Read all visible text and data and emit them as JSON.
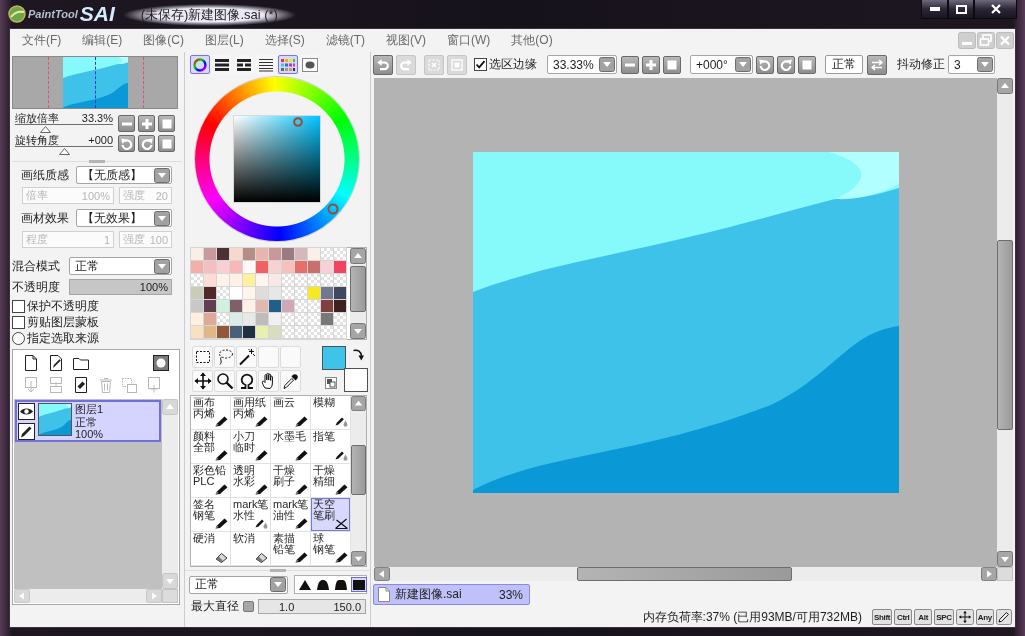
{
  "window": {
    "logo_name": "PaintTool",
    "logo_mark": "SAI",
    "title": "(未保存)新建图像.sai (*)"
  },
  "menu": [
    "文件(F)",
    "编辑(E)",
    "图像(C)",
    "图层(L)",
    "选择(S)",
    "滤镜(T)",
    "视图(V)",
    "窗口(W)",
    "其他(O)"
  ],
  "toolbar": {
    "history": [
      {
        "kind": "undo",
        "disabled": false
      },
      {
        "kind": "redo",
        "disabled": true
      },
      {
        "kind": "deselect",
        "disabled": true
      },
      {
        "kind": "invert",
        "disabled": true
      }
    ],
    "selection_edge": {
      "label": "选区边缘",
      "checked": true
    },
    "zoom": "33.33%",
    "rotation": "+000°",
    "view_mode": "正常",
    "stabilizer": {
      "label": "抖动修正",
      "value": "3"
    }
  },
  "navigator": {
    "zoom": {
      "label": "缩放倍率",
      "value": "33.3%",
      "level": 0.31
    },
    "rotation": {
      "label": "旋转角度",
      "value": "+000",
      "level": 0.5
    }
  },
  "paper_texture": {
    "label": "画纸质感",
    "value": "【无质感】",
    "params": [
      {
        "label": "倍率",
        "value": "100%",
        "disabled": true
      },
      {
        "label": "强度",
        "value": "20",
        "disabled": true
      }
    ]
  },
  "material_effect": {
    "label": "画材效果",
    "value": "【无效果】",
    "params": [
      {
        "label": "程度",
        "value": "1",
        "disabled": true
      },
      {
        "label": "强度",
        "value": "100",
        "disabled": true
      }
    ]
  },
  "layer_properties": {
    "blend": {
      "label": "混合模式",
      "value": "正常"
    },
    "opacity": {
      "label": "不透明度",
      "value": "100%",
      "level": 1
    },
    "options": [
      {
        "kind": "checkbox",
        "label": "保护不透明度",
        "checked": false
      },
      {
        "kind": "checkbox",
        "label": "剪贴图层蒙板",
        "checked": false
      },
      {
        "kind": "radio",
        "label": "指定选取来源",
        "checked": false
      }
    ]
  },
  "layer_tools": [
    {
      "kind": "new-layer",
      "disabled": false
    },
    {
      "kind": "new-vector-layer",
      "disabled": false
    },
    {
      "kind": "new-folder",
      "disabled": false
    },
    {
      "kind": "mask",
      "disabled": false
    },
    {
      "kind": "transfer-down",
      "disabled": true
    },
    {
      "kind": "merge-down",
      "disabled": true
    },
    {
      "kind": "clear",
      "disabled": false
    },
    {
      "kind": "delete",
      "disabled": true
    },
    {
      "kind": "merge-visible",
      "disabled": true
    },
    {
      "kind": "new-mask",
      "disabled": true
    }
  ],
  "layers": [
    {
      "name": "图层1",
      "blend": "正常",
      "opacity": "100%",
      "visible": true,
      "selected": true
    }
  ],
  "color_modes": [
    {
      "kind": "wheel",
      "selected": true
    },
    {
      "kind": "rgb",
      "selected": false
    },
    {
      "kind": "hsv",
      "selected": false
    },
    {
      "kind": "lines",
      "selected": false
    },
    {
      "kind": "swatches",
      "selected": true
    },
    {
      "kind": "scratchpad",
      "selected": false
    }
  ],
  "current_colors": [
    {
      "kind": "foreground",
      "color": "#3ec3ea"
    },
    {
      "kind": "background",
      "color": "#ffffff"
    }
  ],
  "swatches": [
    {
      "kind": "color",
      "color": "#fbeee6"
    },
    {
      "kind": "color",
      "color": "#c99a9c"
    },
    {
      "kind": "color",
      "color": "#4c3036"
    },
    {
      "kind": "color",
      "color": "#f6d8cc"
    },
    {
      "kind": "color",
      "color": "#b68c84"
    },
    {
      "kind": "color",
      "color": "#e8b4ae"
    },
    {
      "kind": "color",
      "color": "#c8989a"
    },
    {
      "kind": "color",
      "color": "#9c7a84"
    },
    {
      "kind": "color",
      "color": "#d4b8bc"
    },
    {
      "kind": "color",
      "color": "#fbefe9"
    },
    {
      "kind": "empty"
    },
    {
      "kind": "empty"
    },
    {
      "kind": "color",
      "color": "#f2b0a8"
    },
    {
      "kind": "color",
      "color": "#f0c0c2"
    },
    {
      "kind": "color",
      "color": "#f8d0d2"
    },
    {
      "kind": "color",
      "color": "#f8b8b8"
    },
    {
      "kind": "color",
      "color": "#fff8f6"
    },
    {
      "kind": "color",
      "color": "#f06262"
    },
    {
      "kind": "color",
      "color": "#f8d2d2"
    },
    {
      "kind": "color",
      "color": "#f8c0ba"
    },
    {
      "kind": "color",
      "color": "#e86e68"
    },
    {
      "kind": "color",
      "color": "#c87070"
    },
    {
      "kind": "color",
      "color": "#f8d0d8"
    },
    {
      "kind": "color",
      "color": "#f04462"
    },
    {
      "kind": "empty"
    },
    {
      "kind": "color",
      "color": "#fcdcd4"
    },
    {
      "kind": "color",
      "color": "#fff2ec"
    },
    {
      "kind": "color",
      "color": "#fff0ea"
    },
    {
      "kind": "color",
      "color": "#fff0a0"
    },
    {
      "kind": "color",
      "color": "#fff4f0"
    },
    {
      "kind": "color",
      "color": "#f8e8e8"
    },
    {
      "kind": "empty"
    },
    {
      "kind": "empty"
    },
    {
      "kind": "empty"
    },
    {
      "kind": "empty"
    },
    {
      "kind": "empty"
    },
    {
      "kind": "color",
      "color": "#c8ccb8"
    },
    {
      "kind": "color",
      "color": "#502828"
    },
    {
      "kind": "empty"
    },
    {
      "kind": "color",
      "color": "#ffffff"
    },
    {
      "kind": "color",
      "color": "#fff4ee"
    },
    {
      "kind": "color",
      "color": "#e0dcdc"
    },
    {
      "kind": "color",
      "color": "#e8e6e6"
    },
    {
      "kind": "empty"
    },
    {
      "kind": "empty"
    },
    {
      "kind": "color",
      "color": "#f8e820"
    },
    {
      "kind": "color",
      "color": "#707890"
    },
    {
      "kind": "color",
      "color": "#404860"
    },
    {
      "kind": "color",
      "color": "#c8c8c8"
    },
    {
      "kind": "color",
      "color": "#604050"
    },
    {
      "kind": "color",
      "color": "#d0f0e0"
    },
    {
      "kind": "color",
      "color": "#806068"
    },
    {
      "kind": "color",
      "color": "#fff0e8"
    },
    {
      "kind": "color",
      "color": "#e0b8b0"
    },
    {
      "kind": "color",
      "color": "#206088"
    },
    {
      "kind": "color",
      "color": "#d0a8b8"
    },
    {
      "kind": "empty"
    },
    {
      "kind": "empty"
    },
    {
      "kind": "color",
      "color": "#804040"
    },
    {
      "kind": "color",
      "color": "#402020"
    },
    {
      "kind": "color",
      "color": "#fff0e0"
    },
    {
      "kind": "color",
      "color": "#e0a898"
    },
    {
      "kind": "empty"
    },
    {
      "kind": "color",
      "color": "#d8ece8"
    },
    {
      "kind": "color",
      "color": "#e8e8e8"
    },
    {
      "kind": "color",
      "color": "#c0bcbc"
    },
    {
      "kind": "color",
      "color": "#f0f0f0"
    },
    {
      "kind": "empty"
    },
    {
      "kind": "empty"
    },
    {
      "kind": "empty"
    },
    {
      "kind": "color",
      "color": "#787878"
    },
    {
      "kind": "empty"
    },
    {
      "kind": "color",
      "color": "#f8e0c0"
    },
    {
      "kind": "color",
      "color": "#e0b888"
    },
    {
      "kind": "color",
      "color": "#905838"
    },
    {
      "kind": "color",
      "color": "#486078"
    },
    {
      "kind": "color",
      "color": "#203040"
    },
    {
      "kind": "color",
      "color": "#e8f0b0"
    },
    {
      "kind": "color",
      "color": "#d8dcc0"
    },
    {
      "kind": "empty"
    },
    {
      "kind": "empty"
    },
    {
      "kind": "empty"
    },
    {
      "kind": "empty"
    },
    {
      "kind": "empty"
    }
  ],
  "brushes": [
    {
      "lines": [
        "画布",
        "丙烯"
      ],
      "kind": "pen",
      "selected": false
    },
    {
      "lines": [
        "画用纸",
        "丙烯"
      ],
      "kind": "pen",
      "selected": false
    },
    {
      "lines": [
        "画云"
      ],
      "kind": "pen",
      "selected": false
    },
    {
      "lines": [
        "模糊"
      ],
      "kind": "water",
      "selected": false
    },
    {
      "lines": [
        "颜料",
        "全部"
      ],
      "kind": "pen",
      "selected": false
    },
    {
      "lines": [
        "小刀",
        "临时"
      ],
      "kind": "pen",
      "selected": false
    },
    {
      "lines": [
        "水墨毛"
      ],
      "kind": "pen",
      "selected": false
    },
    {
      "lines": [
        "指笔"
      ],
      "kind": "water",
      "selected": false
    },
    {
      "lines": [
        "彩色铅",
        "PLC"
      ],
      "kind": "pen",
      "selected": false
    },
    {
      "lines": [
        "透明",
        "水彩"
      ],
      "kind": "pen",
      "selected": false
    },
    {
      "lines": [
        "干燥",
        "刷子"
      ],
      "kind": "pen",
      "selected": false
    },
    {
      "lines": [
        "干燥",
        "精细"
      ],
      "kind": "pen",
      "selected": false
    },
    {
      "lines": [
        "签名",
        "钢笔"
      ],
      "kind": "pen",
      "selected": false
    },
    {
      "lines": [
        "mark笔",
        "水性"
      ],
      "kind": "water",
      "selected": false
    },
    {
      "lines": [
        "mark笔",
        "油性"
      ],
      "kind": "pen",
      "selected": false
    },
    {
      "lines": [
        "天空",
        "笔刷"
      ],
      "kind": "fan",
      "selected": true
    },
    {
      "lines": [
        "硬消"
      ],
      "kind": "eraser",
      "selected": false
    },
    {
      "lines": [
        "软消"
      ],
      "kind": "eraser",
      "selected": false
    },
    {
      "lines": [
        "素描",
        "铅笔"
      ],
      "kind": "pen",
      "selected": false
    },
    {
      "lines": [
        "球",
        "钢笔"
      ],
      "kind": "pen",
      "selected": false
    }
  ],
  "brush_settings": {
    "blend": "正常",
    "shapes": [
      {
        "selected": false
      },
      {
        "selected": false
      },
      {
        "selected": false
      },
      {
        "selected": true
      }
    ],
    "size": {
      "label": "最大直径",
      "scale": "1.0",
      "value": "150.0"
    }
  },
  "document_tabs": [
    {
      "name": "新建图像.sai",
      "zoom": "33%",
      "selected": true
    }
  ],
  "status_bar": {
    "memory": "内存负荷率:37% (已用93MB/可用732MB)",
    "keys": [
      "Shift",
      "Ctrl",
      "Alt",
      "SPC"
    ],
    "any_label": "Any"
  }
}
